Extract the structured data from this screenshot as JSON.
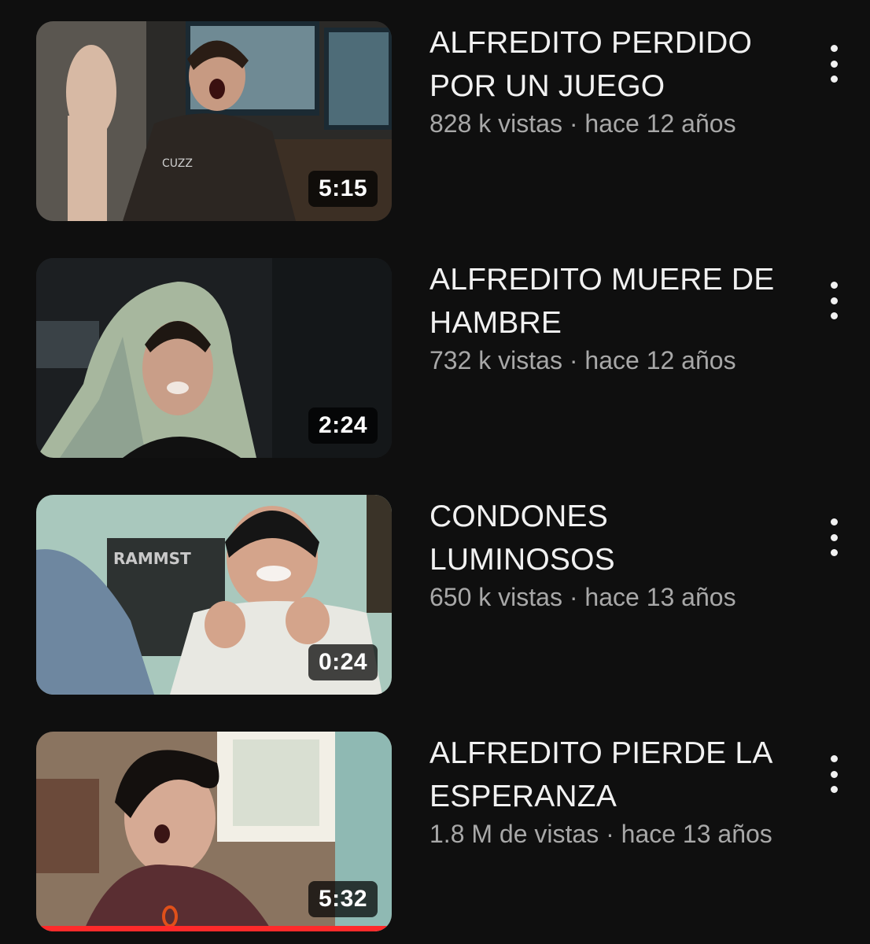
{
  "videos": [
    {
      "title": "ALFREDITO PERDIDO POR UN JUEGO",
      "meta": "828 k vistas · hace 12 años",
      "duration": "5:15",
      "thumbnail_icon": "thumbnail-gamer-screaming-at-monitors"
    },
    {
      "title": "ALFREDITO MUERE DE HAMBRE",
      "meta": "732 k vistas · hace 12 años",
      "duration": "2:24",
      "thumbnail_icon": "thumbnail-hooded-grimacing-face"
    },
    {
      "title": "CONDONES LUMINOSOS",
      "meta": "650 k vistas · hace 13 años",
      "duration": "0:24",
      "thumbnail_icon": "thumbnail-smiling-guy-beanie"
    },
    {
      "title": "ALFREDITO PIERDE LA ESPERANZA",
      "meta": "1.8 M de vistas · hace 13 años",
      "duration": "5:32",
      "thumbnail_icon": "thumbnail-shocked-face-window",
      "watched_fraction": 1.0
    }
  ],
  "colors": {
    "background": "#0f0f0f",
    "title_text": "#f1f1f1",
    "meta_text": "#a8a8a8",
    "progress": "#ff2a2a"
  }
}
